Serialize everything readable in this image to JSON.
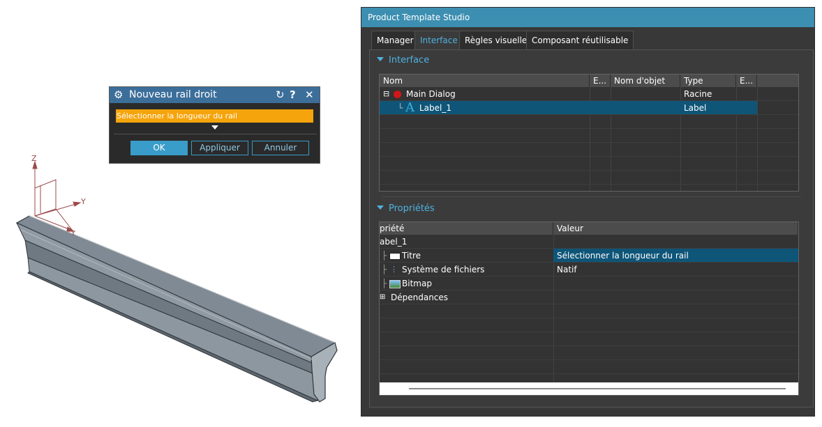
{
  "dialog": {
    "title": "Nouveau rail droit",
    "selection_prompt": "Sélectionner la longueur du rail",
    "ok_label": "OK",
    "apply_label": "Appliquer",
    "cancel_label": "Annuler"
  },
  "axes": {
    "z": "Z",
    "y": "Y",
    "y2": "Y"
  },
  "studio": {
    "window_title": "Product Template Studio",
    "tabs": [
      "Manager",
      "Interface",
      "Règles visuelles",
      "Composant réutilisable"
    ],
    "active_tab": "Interface",
    "interface_section": "Interface",
    "tree_columns": [
      "Nom",
      "E...",
      "Nom d'objet",
      "Type",
      "E..."
    ],
    "tree_rows": [
      {
        "expander": "⊟",
        "name": "Main Dialog",
        "type": "Racine",
        "icon": "red-circle-icon"
      },
      {
        "expander": "",
        "name": "Label_1",
        "type": "Label",
        "icon": "label-A-icon",
        "selected": true
      }
    ],
    "properties_section": "Propriétés",
    "prop_columns": [
      "priété",
      "Valeur"
    ],
    "prop_rows": [
      {
        "name": "abel_1",
        "value": ""
      },
      {
        "name": "Titre",
        "value": "Sélectionner la longueur du rail",
        "icon": "text-field-icon",
        "selected": true
      },
      {
        "name": "Système de fichiers",
        "value": "Natif",
        "icon": "tree-list-icon"
      },
      {
        "name": "Bitmap",
        "value": "",
        "icon": "bitmap-icon"
      },
      {
        "name": "Dépendances",
        "value": "",
        "expander": "⊞"
      }
    ]
  },
  "colors": {
    "accent": "#3d8fb1",
    "highlight": "#f5a40b",
    "selection": "#0e5578"
  }
}
